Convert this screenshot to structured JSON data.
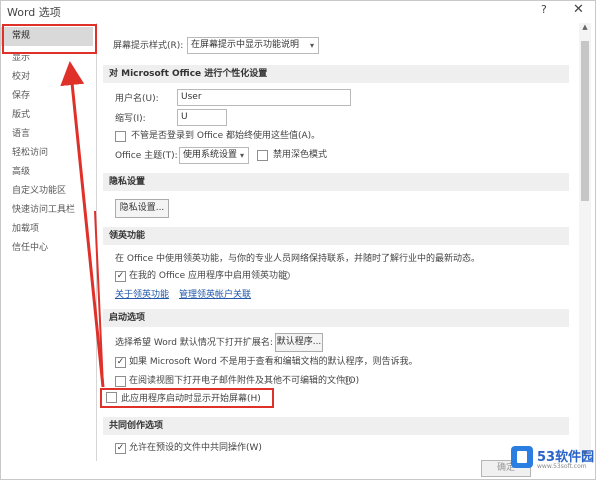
{
  "window": {
    "title": "Word 选项",
    "help": "?",
    "close": "✕"
  },
  "nav": {
    "items": [
      {
        "label": "常规",
        "selected": true
      },
      {
        "label": "显示"
      },
      {
        "label": "校对"
      },
      {
        "label": "保存"
      },
      {
        "label": "版式"
      },
      {
        "label": "语言"
      },
      {
        "label": "轻松访问"
      },
      {
        "label": "高级"
      },
      {
        "label": "自定义功能区"
      },
      {
        "label": "快速访问工具栏"
      },
      {
        "label": "加载项"
      },
      {
        "label": "信任中心"
      }
    ]
  },
  "ui_options": {
    "screentip_label": "屏幕提示样式(R):",
    "screentip_value": "在屏幕提示中显示功能说明"
  },
  "personalize": {
    "header": "对 Microsoft Office 进行个性化设置",
    "username_label": "用户名(U):",
    "username_value": "User",
    "initials_label": "缩写(I):",
    "initials_value": "U",
    "always_use_label": "不管是否登录到 Office 都始终使用这些值(A)。",
    "theme_label": "Office 主题(T):",
    "theme_value": "使用系统设置",
    "dark_mode_label": "禁用深色模式"
  },
  "privacy": {
    "header": "隐私设置",
    "button": "隐私设置..."
  },
  "linkedin": {
    "header": "领英功能",
    "description": "在 Office 中使用领英功能，与你的专业人员网络保持联系，并随时了解行业中的最新动态。",
    "enable_label": "在我的 Office 应用程序中启用领英功能",
    "link_about": "关于领英功能",
    "link_manage": "管理领英帐户关联"
  },
  "startup": {
    "header": "启动选项",
    "default_programs_label": "选择希望 Word 默认情况下打开扩展名:",
    "default_programs_button": "默认程序...",
    "tell_me_label": "如果 Microsoft Word 不是用于查看和编辑文档的默认程序，则告诉我。",
    "reading_view_label": "在阅读视图下打开电子邮件附件及其他不可编辑的文件(O)",
    "start_screen_label": "此应用程序启动时显示开始屏幕(H)"
  },
  "coauthoring": {
    "header": "共同创作选项",
    "allow_label": "允许在预设的文件中共同操作(W)"
  },
  "footer": {
    "ok": "确定"
  },
  "watermark": {
    "brand": "53软件园",
    "url": "www.53soft.com"
  },
  "colors": {
    "annotation_red": "#e0302a",
    "selected_nav": "#d9d9d9",
    "link_blue": "#1f56a8"
  }
}
